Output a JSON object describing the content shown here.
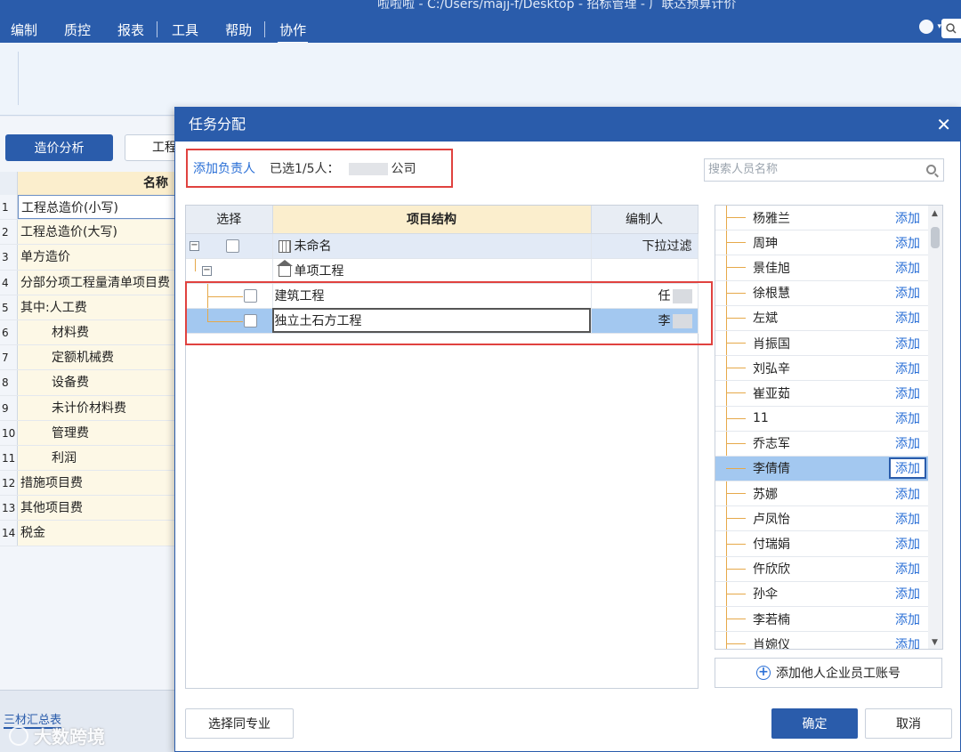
{
  "window": {
    "title": "啦啦啦 - C:/Users/majj-f/Desktop - 招标管理 - 广联达预算计价"
  },
  "menu": [
    "编制",
    "质控",
    "报表",
    "工具",
    "帮助",
    "协作"
  ],
  "left": {
    "cost_button": "造价分析",
    "proj_button": "工程",
    "header": "名称",
    "rows": [
      {
        "n": "1",
        "label": "工程总造价(小写)",
        "indent": false
      },
      {
        "n": "2",
        "label": "工程总造价(大写)",
        "indent": false
      },
      {
        "n": "3",
        "label": "单方造价",
        "indent": false
      },
      {
        "n": "4",
        "label": "分部分项工程量清单项目费",
        "indent": false
      },
      {
        "n": "5",
        "label": "其中:人工费",
        "indent": false
      },
      {
        "n": "6",
        "label": "材料费",
        "indent": true
      },
      {
        "n": "7",
        "label": "定额机械费",
        "indent": true
      },
      {
        "n": "8",
        "label": "设备费",
        "indent": true
      },
      {
        "n": "9",
        "label": "未计价材料费",
        "indent": true
      },
      {
        "n": "10",
        "label": "管理费",
        "indent": true
      },
      {
        "n": "11",
        "label": "利润",
        "indent": true
      },
      {
        "n": "12",
        "label": "措施项目费",
        "indent": false
      },
      {
        "n": "13",
        "label": "其他项目费",
        "indent": false
      },
      {
        "n": "14",
        "label": "税金",
        "indent": false
      }
    ],
    "bottom_tab": "三材汇总表",
    "watermark": "大数跨境"
  },
  "dialog": {
    "title": "任务分配",
    "add_owner": "添加负责人",
    "selected_prefix": "已选1/5人：",
    "company_suffix": "公司",
    "search_placeholder": "搜索人员名称",
    "table": {
      "col_select": "选择",
      "col_structure": "项目结构",
      "col_owner": "编制人",
      "rows": [
        {
          "name": "未命名",
          "owner": "下拉过滤"
        },
        {
          "name": "单项工程",
          "owner": ""
        },
        {
          "name": "建筑工程",
          "owner": "任"
        },
        {
          "name": "独立土石方工程",
          "owner": "李"
        }
      ]
    },
    "people": [
      "杨雅兰",
      "周珅",
      "景佳旭",
      "徐根慧",
      "左斌",
      "肖振国",
      "刘弘辛",
      "崔亚茹",
      "11",
      "乔志军",
      "李倩倩",
      "苏娜",
      "卢凤怡",
      "付瑞娟",
      "仵欣欣",
      "孙伞",
      "李若楠",
      "肖婉仪"
    ],
    "add_label": "添加",
    "add_other": "添加他人企业员工账号",
    "btn_same": "选择同专业",
    "btn_ok": "确定",
    "btn_cancel": "取消"
  }
}
